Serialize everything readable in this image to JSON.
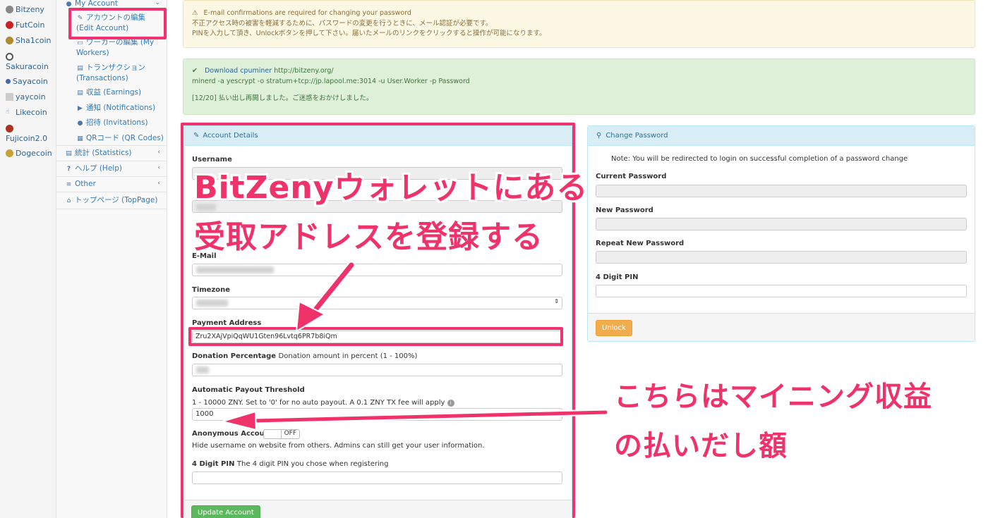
{
  "coins": [
    {
      "name": "Bitzeny",
      "color": "#888888"
    },
    {
      "name": "FutCoin",
      "color": "#cc2222"
    },
    {
      "name": "Sha1coin",
      "color": "#b08a30"
    },
    {
      "name": "Sakuracoin",
      "color": "#555555"
    },
    {
      "name": "Sayacoin",
      "color": "#4466aa"
    },
    {
      "name": "yaycoin",
      "color": "#999999"
    },
    {
      "name": "Likecoin",
      "color": "#4a79a8"
    },
    {
      "name": "Fujicoin2.0",
      "color": "#aa3322"
    },
    {
      "name": "Dogecoin",
      "color": "#c8a035"
    }
  ],
  "nav": {
    "my_account": "My Account",
    "edit_account": "アカウントの編集 (Edit Account)",
    "workers": "ワーカーの編集 (My Workers)",
    "transactions": "トランザクション (Transactions)",
    "earnings": "収益 (Earnings)",
    "notifications": "通知 (Notifications)",
    "invitations": "招待 (Invitations)",
    "qrcodes": "QRコード (QR Codes)",
    "statistics": "統計 (Statistics)",
    "help": "ヘルプ (Help)",
    "other": "Other",
    "toppage": "トップページ (TopPage)"
  },
  "alerts": {
    "warning_title": "E-mail confirmations are required for changing your password",
    "warning_line2": "不正アクセス時の被害を軽減するために、パスワードの変更を行うときに、メール認証が必要です。",
    "warning_line3": "PINを入力して頂き、Unlockボタンを押して下さい。届いたメールのリンクをクリックすると操作が可能になります。",
    "download_link": "Download cpuminer",
    "download_url": "http://bitzeny.org/",
    "command": "minerd -a yescrypt -o stratum+tcp://jp.lapool.me:3014 -u User.Worker -p Password",
    "notice": "[12/20] 払い出し再開しました。ご迷惑をおかけしました。"
  },
  "account": {
    "header": "Account Details",
    "username_label": "Username",
    "email_label": "E-Mail",
    "timezone_label": "Timezone",
    "payment_label": "Payment Address",
    "payment_value": "Zru2XAjVpiQqWU1Gten96Lvtq6PR7b8iQm",
    "donation_label": "Donation Percentage",
    "donation_hint": "Donation amount in percent (1 - 100%)",
    "payout_label": "Automatic Payout Threshold",
    "payout_hint": "1 - 10000 ZNY. Set to '0' for no auto payout. A 0.1 ZNY TX fee will apply",
    "payout_value": "1000",
    "anon_label": "Anonymous Account",
    "anon_state": "OFF",
    "anon_hint": "Hide username on website from others. Admins can still get your user information.",
    "pin_label": "4 Digit PIN",
    "pin_hint": "The 4 digit PIN you chose when registering",
    "update_button": "Update Account"
  },
  "password": {
    "header": "Change Password",
    "note": "Note: You will be redirected to login on successful completion of a password change",
    "current_label": "Current Password",
    "new_label": "New Password",
    "repeat_label": "Repeat New Password",
    "pin_label": "4 Digit PIN",
    "unlock_button": "Unlock"
  },
  "annotations": {
    "caption1_line1": "BitZenyウォレットにある",
    "caption1_line2": "受取アドレスを登録する",
    "caption2_line1": "こちらはマイニング収益",
    "caption2_line2": "の払いだし額",
    "accent": "#f0326b"
  }
}
